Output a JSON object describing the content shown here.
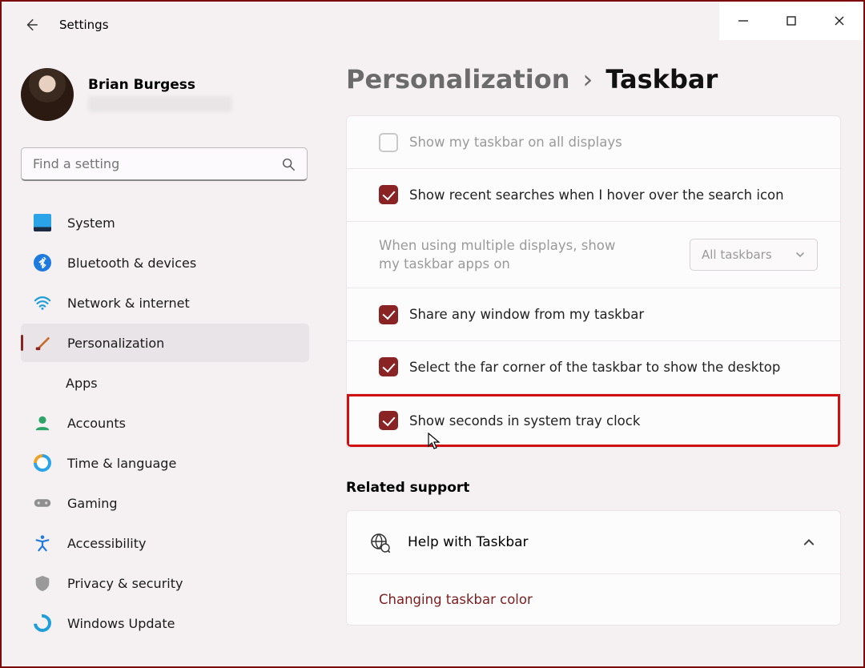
{
  "window": {
    "app_title": "Settings"
  },
  "user": {
    "name": "Brian Burgess"
  },
  "search": {
    "placeholder": "Find a setting"
  },
  "sidebar": {
    "items": [
      {
        "label": "System"
      },
      {
        "label": "Bluetooth & devices"
      },
      {
        "label": "Network & internet"
      },
      {
        "label": "Personalization"
      },
      {
        "label": "Apps"
      },
      {
        "label": "Accounts"
      },
      {
        "label": "Time & language"
      },
      {
        "label": "Gaming"
      },
      {
        "label": "Accessibility"
      },
      {
        "label": "Privacy & security"
      },
      {
        "label": "Windows Update"
      }
    ]
  },
  "breadcrumb": {
    "parent": "Personalization",
    "current": "Taskbar"
  },
  "rows": {
    "show_all_displays": "Show my taskbar on all displays",
    "recent_searches": "Show recent searches when I hover over the search icon",
    "multi_displays_label": "When using multiple displays, show my taskbar apps on",
    "multi_displays_value": "All taskbars",
    "share_window": "Share any window from my taskbar",
    "far_corner": "Select the far corner of the taskbar to show the desktop",
    "show_seconds": "Show seconds in system tray clock"
  },
  "related": {
    "title": "Related support",
    "help_title": "Help with Taskbar",
    "link1": "Changing taskbar color"
  }
}
